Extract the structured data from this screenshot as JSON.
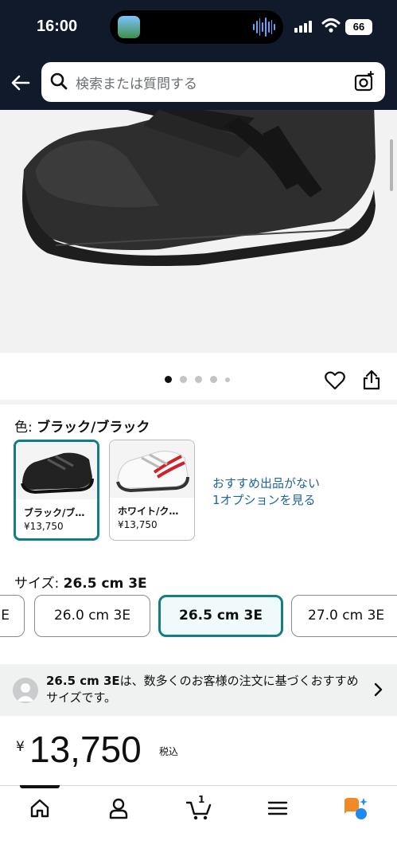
{
  "status_bar": {
    "time": "16:00",
    "battery": "66",
    "icons": [
      "app-thumbnail-icon",
      "audio-wave-icon",
      "cellular-signal-icon",
      "wifi-icon",
      "battery-icon"
    ]
  },
  "search": {
    "placeholder": "検索または質問する",
    "icons": [
      "back-arrow-icon",
      "search-icon",
      "camera-icon"
    ]
  },
  "gallery": {
    "page_count": 5,
    "active_page": 1,
    "icons": [
      "heart-icon",
      "share-icon"
    ]
  },
  "color": {
    "label": "色: ",
    "selected": "ブラック/ブラック",
    "options": [
      {
        "name": "ブラック/ブ…",
        "price": "¥13,750",
        "selected": true
      },
      {
        "name": "ホワイト/ク…",
        "price": "¥13,750",
        "selected": false
      }
    ],
    "recommend_line1": "おすすめ出品がない",
    "recommend_line2": "1オプションを見る"
  },
  "size": {
    "label": "サイズ: ",
    "selected": "26.5 cm 3E",
    "options": [
      {
        "label": "E",
        "selected": false
      },
      {
        "label": "26.0 cm 3E",
        "selected": false
      },
      {
        "label": "26.5 cm 3E",
        "selected": true
      },
      {
        "label": "27.0 cm 3E",
        "selected": false
      }
    ]
  },
  "recommendation": {
    "size": "26.5 cm 3E",
    "text": "は、数多くのお客様の注文に基づくおすすめサイズです。"
  },
  "price": {
    "symbol": "¥",
    "value": "13,750",
    "tax": "税込"
  },
  "tabbar": {
    "cart_count": "1",
    "tabs": [
      "home-icon",
      "account-icon",
      "cart-icon",
      "menu-icon",
      "rufus-icon"
    ]
  },
  "colors": {
    "header_bg": "#101a2b",
    "accent_teal": "#127d85",
    "link_blue": "#2162a1"
  }
}
